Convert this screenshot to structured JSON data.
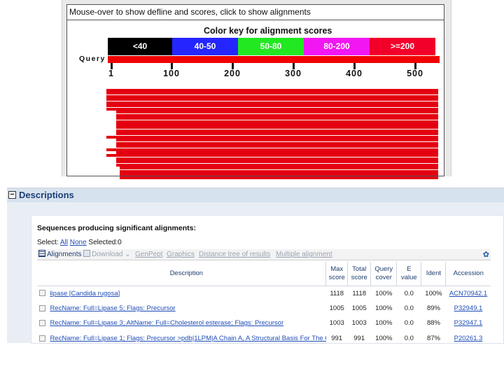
{
  "graphic": {
    "hint": "Mouse-over to show defline and scores, click to show alignments",
    "color_key_title": "Color key for alignment scores",
    "color_key": [
      {
        "label": "<40",
        "bg": "#000000",
        "fg": "#ffffff"
      },
      {
        "label": "40-50",
        "bg": "#2525ff",
        "fg": "#ffffff"
      },
      {
        "label": "50-80",
        "bg": "#22e822",
        "fg": "#ffffff"
      },
      {
        "label": "80-200",
        "bg": "#f216f2",
        "fg": "#ffffff"
      },
      {
        "label": ">=200",
        "bg": "#f2002a",
        "fg": "#ffffff"
      }
    ],
    "query_label": "Query",
    "ruler_ticks": [
      "1",
      "100",
      "200",
      "300",
      "400",
      "500"
    ],
    "hit_color": "#e40010"
  },
  "descriptions": {
    "title": "Descriptions",
    "sequences_heading": "Sequences producing significant alignments:",
    "select_label": "Select:",
    "select_all": "All",
    "select_none": "None",
    "selected_text": "Selected:0",
    "toolbar": {
      "alignments": "Alignments",
      "download": "Download",
      "genpept": "GenPept",
      "graphics": "Graphics",
      "distance_tree": "Distance tree of results",
      "multiple_alignment": "Multiple alignment"
    },
    "columns": {
      "description": "Description",
      "max_score": [
        "Max",
        "score"
      ],
      "total_score": [
        "Total",
        "score"
      ],
      "query_cover": [
        "Query",
        "cover"
      ],
      "e_value": [
        "E",
        "value"
      ],
      "ident": "Ident",
      "accession": "Accession"
    },
    "rows": [
      {
        "description": "lipase [Candida rugosa]",
        "max": "1118",
        "total": "1118",
        "cover": "100%",
        "evalue": "0.0",
        "ident": "100%",
        "accession": "ACN70942.1"
      },
      {
        "description": "RecName: Full=Lipase 5; Flags: Precursor",
        "max": "1005",
        "total": "1005",
        "cover": "100%",
        "evalue": "0.0",
        "ident": "89%",
        "accession": "P32949.1"
      },
      {
        "description": "RecName: Full=Lipase 3; AltName: Full=Cholesterol esterase; Flags: Precursor",
        "max": "1003",
        "total": "1003",
        "cover": "100%",
        "evalue": "0.0",
        "ident": "88%",
        "accession": "P32947.1"
      },
      {
        "description": "RecName: Full=Lipase 1; Flags: Precursor >pdb|1LPM|A Chain A, A Structural Basis For The C",
        "max": "991",
        "total": "991",
        "cover": "100%",
        "evalue": "0.0",
        "ident": "87%",
        "accession": "P20261.3"
      }
    ]
  }
}
